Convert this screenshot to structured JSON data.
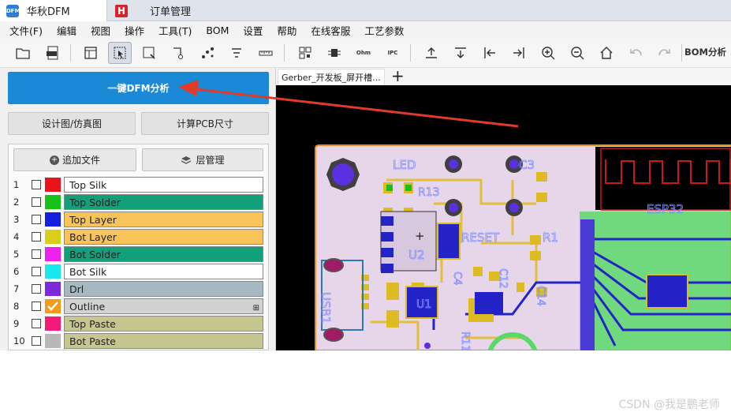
{
  "tabs": {
    "main": "华秋DFM",
    "order": "订单管理",
    "logo_main": "DFM",
    "logo_order": "H"
  },
  "menu": [
    "文件(F)",
    "编辑",
    "视图",
    "操作",
    "工具(T)",
    "BOM",
    "设置",
    "帮助",
    "在线客服",
    "工艺参数"
  ],
  "toolbar": {
    "bom_label": "BOM分析",
    "pdf": "PDF",
    "ohm": "Ohm",
    "ipc": "IPC"
  },
  "panel": {
    "dfm_button": "一键DFM分析",
    "design_button": "设计图/仿真图",
    "pcb_size_button": "计算PCB尺寸",
    "add_file": "追加文件",
    "layer_manage": "层管理",
    "layers": [
      {
        "num": "1",
        "name": "Top Silk",
        "swatch": "#e8141c",
        "bg": "#ffffff"
      },
      {
        "num": "2",
        "name": "Top Solder",
        "swatch": "#16c21a",
        "bg": "#12a07a"
      },
      {
        "num": "3",
        "name": "Top Layer",
        "swatch": "#1420e0",
        "bg": "#f8c45a"
      },
      {
        "num": "4",
        "name": "Bot Layer",
        "swatch": "#d9cf1a",
        "bg": "#f8c45a"
      },
      {
        "num": "5",
        "name": "Bot Solder",
        "swatch": "#ee22ee",
        "bg": "#12a07a"
      },
      {
        "num": "6",
        "name": "Bot Silk",
        "swatch": "#18e8ee",
        "bg": "#ffffff"
      },
      {
        "num": "7",
        "name": "Drl",
        "swatch": "#7a2ad8",
        "bg": "#a6b8c2"
      },
      {
        "num": "8",
        "name": "Outline",
        "swatch": "#f49a1c",
        "bg": "#d2d2d2"
      },
      {
        "num": "9",
        "name": "Top Paste",
        "swatch": "#f21a7a",
        "bg": "#c6c690"
      },
      {
        "num": "10",
        "name": "Bot Paste",
        "swatch": "#b8b8b8",
        "bg": "#c6c690"
      }
    ]
  },
  "viewer": {
    "doc_tab": "Gerber_开发板_屏开槽...",
    "add_tab": "+",
    "silk": {
      "led": "LED",
      "c3": "C3",
      "r13": "R13",
      "reset": "RESET",
      "r1": "R1",
      "u2": "U2",
      "usb1": "USB1",
      "esp32": "ESP32",
      "c4": "C4",
      "c12": "C12",
      "r11": "R11",
      "c14": "C14",
      "u1": "U1",
      "plus": "+"
    }
  },
  "watermark": "CSDN @我是鹏老师",
  "colors": {
    "accent": "#1a89d6",
    "arrow": "#e03a2a",
    "board": "#e7d6ea",
    "copper": "#e3bf3c",
    "trace": "#2323c8"
  }
}
